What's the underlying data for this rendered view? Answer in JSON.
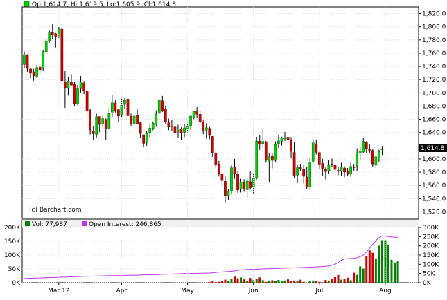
{
  "chart_data": [
    {
      "type": "candlestick",
      "legend": "Op:1,614.7, Hi:1,619.5, Lo:1,605.9, Cl:1,614.8",
      "watermark": "(c) Barchart.com",
      "last_price_label": "1,614.8",
      "last_price": 1614.8,
      "ylim": [
        1510,
        1830
      ],
      "y_ticks": [
        {
          "v": 1820,
          "label": "1,820.0"
        },
        {
          "v": 1800,
          "label": "1,800.0"
        },
        {
          "v": 1780,
          "label": "1,780.0"
        },
        {
          "v": 1760,
          "label": "1,760.0"
        },
        {
          "v": 1740,
          "label": "1,740.0"
        },
        {
          "v": 1720,
          "label": "1,720.0"
        },
        {
          "v": 1700,
          "label": "1,700.0"
        },
        {
          "v": 1680,
          "label": "1,680.0"
        },
        {
          "v": 1660,
          "label": "1,660.0"
        },
        {
          "v": 1640,
          "label": "1,640.0"
        },
        {
          "v": 1600,
          "label": "1,600.0"
        },
        {
          "v": 1580,
          "label": "1,580.0"
        },
        {
          "v": 1560,
          "label": "1,560.0"
        },
        {
          "v": 1540,
          "label": "1,540.0"
        },
        {
          "v": 1520,
          "label": "1,520.0"
        }
      ],
      "x_ticks": [
        {
          "i": 11,
          "label": "Mar 12"
        },
        {
          "i": 31,
          "label": "Apr"
        },
        {
          "i": 52,
          "label": "May"
        },
        {
          "i": 73,
          "label": "Jun"
        },
        {
          "i": 94,
          "label": "Jul"
        },
        {
          "i": 115,
          "label": "Aug"
        }
      ],
      "candles": [
        [
          1742.8,
          1762.7,
          1737.8,
          1757.7
        ],
        [
          1756.9,
          1758.4,
          1731.8,
          1736.8
        ],
        [
          1735.9,
          1737.6,
          1722.0,
          1729.9
        ],
        [
          1731.6,
          1736.2,
          1718.3,
          1725.6
        ],
        [
          1724.9,
          1742.5,
          1722.4,
          1738.1
        ],
        [
          1738.9,
          1740.3,
          1730.5,
          1735.0
        ],
        [
          1736.9,
          1764.5,
          1733.0,
          1762.5
        ],
        [
          1762.4,
          1781.1,
          1760.3,
          1778.4
        ],
        [
          1778.7,
          1794.2,
          1775.6,
          1790.7
        ],
        [
          1791.1,
          1804.5,
          1781.6,
          1788.2
        ],
        [
          1789.5,
          1790.5,
          1768.6,
          1784.6
        ],
        [
          1784.5,
          1799.7,
          1783.0,
          1796.8
        ],
        [
          1796.5,
          1799.5,
          1714.1,
          1718.4
        ],
        [
          1716.6,
          1733.4,
          1677.2,
          1707.5
        ],
        [
          1706.6,
          1724.1,
          1695.8,
          1717.8
        ],
        [
          1716.3,
          1728.2,
          1711.0,
          1711.7
        ],
        [
          1712.5,
          1716.0,
          1679.6,
          1683.7
        ],
        [
          1682.8,
          1711.8,
          1681.1,
          1706.0
        ],
        [
          1706.2,
          1725.3,
          1700.5,
          1716.4
        ],
        [
          1714.8,
          1717.9,
          1698.1,
          1702.6
        ],
        [
          1702.9,
          1704.0,
          1667.0,
          1672.8
        ],
        [
          1673.7,
          1675.9,
          1637.0,
          1643.8
        ],
        [
          1642.5,
          1650.0,
          1628.2,
          1638.2
        ],
        [
          1637.1,
          1668.4,
          1632.5,
          1663.8
        ],
        [
          1664.2,
          1664.1,
          1640.7,
          1652.0
        ],
        [
          1653.0,
          1667.3,
          1647.7,
          1661.9
        ],
        [
          1659.8,
          1661.2,
          1628.4,
          1645.6
        ],
        [
          1646.4,
          1675.5,
          1643.4,
          1668.9
        ],
        [
          1670.9,
          1696.3,
          1663.3,
          1684.8
        ],
        [
          1684.5,
          1688.7,
          1670.2,
          1673.2
        ],
        [
          1674.5,
          1675.6,
          1655.5,
          1665.0
        ],
        [
          1666.2,
          1692.2,
          1661.5,
          1681.3
        ],
        [
          1682.4,
          1691.8,
          1675.2,
          1688.6
        ],
        [
          1690.5,
          1694.6,
          1658.4,
          1665.3
        ],
        [
          1664.5,
          1668.5,
          1649.4,
          1653.9
        ],
        [
          1653.1,
          1668.1,
          1645.7,
          1664.8
        ],
        [
          1666.0,
          1675.1,
          1652.3,
          1653.4
        ],
        [
          1654.6,
          1655.4,
          1632.1,
          1638.4
        ],
        [
          1636.5,
          1637.0,
          1617.9,
          1623.6
        ],
        [
          1624.9,
          1642.1,
          1620.0,
          1638.2
        ],
        [
          1638.9,
          1653.8,
          1632.2,
          1646.6
        ],
        [
          1646.1,
          1656.6,
          1643.4,
          1654.0
        ],
        [
          1652.7,
          1673.6,
          1648.7,
          1667.5
        ],
        [
          1669.3,
          1689.2,
          1667.4,
          1688.8
        ],
        [
          1687.9,
          1695.3,
          1671.0,
          1673.6
        ],
        [
          1674.8,
          1681.0,
          1652.8,
          1655.7
        ],
        [
          1654.8,
          1661.0,
          1643.5,
          1648.3
        ],
        [
          1649.1,
          1658.7,
          1642.8,
          1650.1
        ],
        [
          1648.4,
          1651.6,
          1630.7,
          1640.1
        ],
        [
          1641.6,
          1651.8,
          1631.5,
          1645.5
        ],
        [
          1645.3,
          1647.9,
          1628.9,
          1639.3
        ],
        [
          1640.2,
          1652.3,
          1633.1,
          1646.9
        ],
        [
          1645.1,
          1654.3,
          1640.2,
          1650.1
        ],
        [
          1650.1,
          1666.8,
          1644.4,
          1664.6
        ],
        [
          1662.7,
          1672.0,
          1660.2,
          1671.7
        ],
        [
          1672.9,
          1678.4,
          1661.9,
          1667.6
        ],
        [
          1667.6,
          1673.3,
          1653.5,
          1655.6
        ],
        [
          1655.6,
          1658.3,
          1637.3,
          1643.4
        ],
        [
          1643.6,
          1654.0,
          1630.7,
          1647.1
        ],
        [
          1646.3,
          1648.8,
          1629.7,
          1635.5
        ],
        [
          1634.0,
          1634.6,
          1602.9,
          1608.9
        ],
        [
          1608.5,
          1612.3,
          1586.1,
          1590.6
        ],
        [
          1592.2,
          1597.0,
          1573.5,
          1578.2
        ],
        [
          1577.1,
          1580.6,
          1559.0,
          1567.3
        ],
        [
          1566.0,
          1574.2,
          1534.0,
          1544.5
        ],
        [
          1544.8,
          1554.5,
          1537.5,
          1550.7
        ],
        [
          1551.6,
          1590.5,
          1546.8,
          1586.7
        ],
        [
          1587.5,
          1600.1,
          1570.0,
          1577.1
        ],
        [
          1577.6,
          1581.1,
          1548.6,
          1553.1
        ],
        [
          1554.2,
          1570.0,
          1549.3,
          1564.9
        ],
        [
          1564.5,
          1569.2,
          1550.3,
          1554.4
        ],
        [
          1553.5,
          1571.0,
          1540.2,
          1566.5
        ],
        [
          1565.5,
          1580.9,
          1553.5,
          1556.5
        ],
        [
          1557.5,
          1578.2,
          1547.8,
          1571.5
        ],
        [
          1570.7,
          1633.5,
          1569.1,
          1626.9
        ],
        [
          1626.7,
          1636.2,
          1613.9,
          1622.4
        ],
        [
          1622.9,
          1645.8,
          1617.3,
          1626.5
        ],
        [
          1625.2,
          1627.2,
          1594.3,
          1598.0
        ],
        [
          1596.6,
          1608.5,
          1565.2,
          1603.4
        ],
        [
          1604.7,
          1607.8,
          1585.7,
          1597.8
        ],
        [
          1597.8,
          1626.5,
          1594.6,
          1621.7
        ],
        [
          1623.1,
          1636.0,
          1616.7,
          1627.3
        ],
        [
          1626.8,
          1633.6,
          1620.1,
          1632.0
        ],
        [
          1630.5,
          1640.7,
          1627.0,
          1631.6
        ],
        [
          1632.9,
          1637.3,
          1625.0,
          1628.7
        ],
        [
          1628.4,
          1633.0,
          1600.8,
          1611.4
        ],
        [
          1609.7,
          1625.3,
          1571.0,
          1575.3
        ],
        [
          1575.6,
          1591.0,
          1563.4,
          1586.8
        ],
        [
          1587.0,
          1592.7,
          1581.7,
          1584.5
        ],
        [
          1584.3,
          1591.5,
          1563.0,
          1573.8
        ],
        [
          1572.7,
          1587.5,
          1553.9,
          1557.8
        ],
        [
          1557.9,
          1601.2,
          1553.3,
          1595.4
        ],
        [
          1596.4,
          1629.6,
          1593.5,
          1624.3
        ],
        [
          1622.8,
          1628.3,
          1606.8,
          1610.2
        ],
        [
          1609.7,
          1610.8,
          1585.0,
          1592.1
        ],
        [
          1593.2,
          1600.3,
          1574.6,
          1585.7
        ],
        [
          1583.9,
          1587.1,
          1569.0,
          1580.9
        ],
        [
          1582.1,
          1598.5,
          1577.2,
          1591.5
        ],
        [
          1592.2,
          1600.4,
          1588.4,
          1591.3
        ],
        [
          1590.2,
          1596.3,
          1580.6,
          1584.1
        ],
        [
          1582.6,
          1588.6,
          1575.4,
          1581.1
        ],
        [
          1581.4,
          1594.2,
          1574.6,
          1587.5
        ],
        [
          1586.3,
          1588.9,
          1572.7,
          1580.2
        ],
        [
          1580.7,
          1586.4,
          1574.9,
          1576.8
        ],
        [
          1577.1,
          1594.5,
          1573.0,
          1588.6
        ],
        [
          1587.9,
          1592.4,
          1582.4,
          1587.6
        ],
        [
          1589.4,
          1616.0,
          1581.1,
          1609.3
        ],
        [
          1609.2,
          1617.8,
          1599.2,
          1611.6
        ],
        [
          1610.5,
          1631.4,
          1608.4,
          1626.4
        ],
        [
          1625.6,
          1626.7,
          1609.3,
          1615.9
        ],
        [
          1615.4,
          1622.2,
          1609.1,
          1613.1
        ],
        [
          1612.7,
          1614.9,
          1587.6,
          1592.5
        ],
        [
          1590.6,
          1605.2,
          1586.5,
          1603.3
        ],
        [
          1601.4,
          1613.9,
          1595.5,
          1611.2
        ],
        [
          1614.7,
          1619.5,
          1605.9,
          1614.8
        ]
      ]
    },
    {
      "type": "bar+line",
      "legend_volume": "Vol: 77,987",
      "legend_oi": "Open Interest: 246,865",
      "colors": {
        "volume_up": "#008000",
        "volume_down": "#cc0000",
        "open_interest": "#bb33ee"
      },
      "volume_ylim": [
        0,
        200000
      ],
      "oi_ylim": [
        0,
        300000
      ],
      "volume_ticks": [
        {
          "v": 200000,
          "label": "200K"
        },
        {
          "v": 150000,
          "label": "150K"
        },
        {
          "v": 100000,
          "label": "100K"
        },
        {
          "v": 50000,
          "label": "50K"
        },
        {
          "v": 0,
          "label": "0K"
        }
      ],
      "oi_ticks": [
        {
          "v": 300000,
          "label": "300K"
        },
        {
          "v": 250000,
          "label": "250K"
        },
        {
          "v": 200000,
          "label": "200K"
        },
        {
          "v": 150000,
          "label": "150K"
        },
        {
          "v": 100000,
          "label": "100K"
        },
        {
          "v": 50000,
          "label": "50K"
        },
        {
          "v": 0,
          "label": "0K"
        }
      ],
      "volume": [
        0,
        0,
        0,
        0,
        0,
        0,
        0,
        0,
        0,
        0,
        0,
        0,
        0,
        0,
        0,
        0,
        0,
        0,
        0,
        0,
        0,
        0,
        0,
        0,
        0,
        0,
        0,
        0,
        0,
        0,
        0,
        0,
        0,
        0,
        0,
        0,
        0,
        0,
        0,
        0,
        0,
        0,
        0,
        0,
        0,
        0,
        0,
        0,
        1000,
        0,
        0,
        0,
        0,
        0,
        0,
        0,
        1500,
        0,
        0,
        2000,
        5000,
        0,
        3000,
        6000,
        11000,
        7000,
        14000,
        22000,
        16000,
        19000,
        12000,
        6000,
        17000,
        9000,
        14000,
        19000,
        9000,
        3000,
        8000,
        9000,
        6000,
        10000,
        6000,
        8000,
        12000,
        7000,
        8000,
        6000,
        11000,
        3000,
        0,
        6000,
        8000,
        5000,
        3000,
        0,
        10000,
        8000,
        13000,
        20000,
        28000,
        11000,
        13000,
        18000,
        9000,
        36000,
        28000,
        59000,
        51000,
        97000,
        117000,
        108000,
        88000,
        134000,
        154000,
        154000,
        138000,
        83000,
        73000,
        78000
      ],
      "open_interest": [
        23000,
        23600,
        24200,
        24800,
        25400,
        26000,
        26600,
        27200,
        27800,
        28400,
        29000,
        29600,
        30200,
        30800,
        31400,
        32000,
        32600,
        33200,
        33800,
        34400,
        35000,
        35400,
        35800,
        36200,
        36600,
        37000,
        37400,
        37800,
        38200,
        38600,
        39000,
        39400,
        39800,
        40200,
        40600,
        41000,
        41400,
        41800,
        42200,
        42600,
        43000,
        43600,
        44200,
        44800,
        45400,
        46000,
        46600,
        47200,
        47800,
        48400,
        49000,
        49400,
        49800,
        50200,
        50600,
        51000,
        51400,
        51800,
        52200,
        52600,
        54000,
        56000,
        57000,
        58000,
        60000,
        61000,
        62000,
        64000,
        67000,
        69000,
        71000,
        72000,
        72600,
        73200,
        73800,
        74400,
        75000,
        75600,
        76200,
        76800,
        77400,
        78000,
        78600,
        79200,
        79800,
        80400,
        81000,
        81600,
        82200,
        82800,
        83600,
        84400,
        85200,
        86000,
        86800,
        88000,
        89000,
        91000,
        95000,
        100000,
        110000,
        122000,
        129000,
        131000,
        131000,
        133000,
        136000,
        141000,
        150000,
        167000,
        187000,
        208000,
        228000,
        245000,
        254000,
        252000,
        250000,
        248000,
        247000,
        246865
      ],
      "x_ticks": [
        {
          "i": 11,
          "label": "Mar 12"
        },
        {
          "i": 31,
          "label": "Apr"
        },
        {
          "i": 52,
          "label": "May"
        },
        {
          "i": 73,
          "label": "Jun"
        },
        {
          "i": 94,
          "label": "Jul"
        },
        {
          "i": 115,
          "label": "Aug"
        }
      ]
    }
  ]
}
